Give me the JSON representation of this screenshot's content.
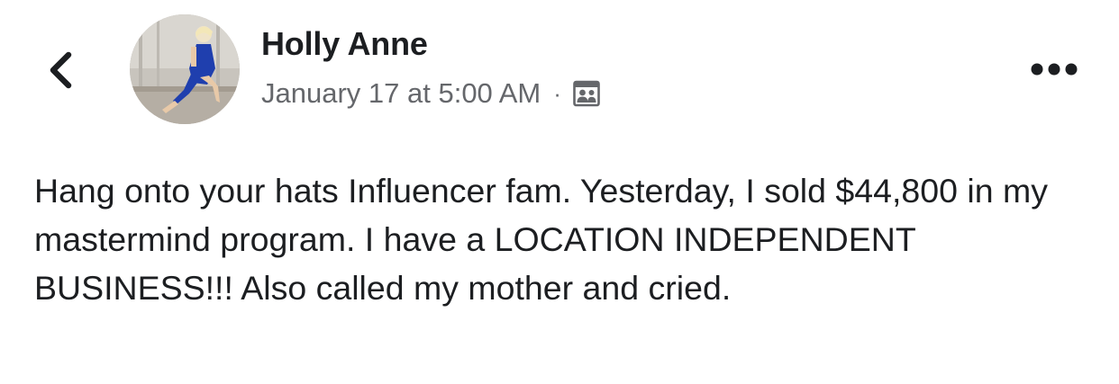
{
  "post": {
    "author_name": "Holly Anne",
    "timestamp": "January 17 at 5:00 AM",
    "separator": "·",
    "audience_icon": "group-audience-icon",
    "text": "Hang onto your hats Influencer fam. Yesterday, I sold $44,800 in my mastermind program. I have a LOCATION INDEPENDENT BUSINESS!!! Also called my mother and cried."
  },
  "header": {
    "back_icon": "chevron-left-icon",
    "more_icon": "more-horizontal-icon"
  },
  "colors": {
    "text_primary": "#1c1e21",
    "text_secondary": "#65676b",
    "background": "#ffffff"
  }
}
